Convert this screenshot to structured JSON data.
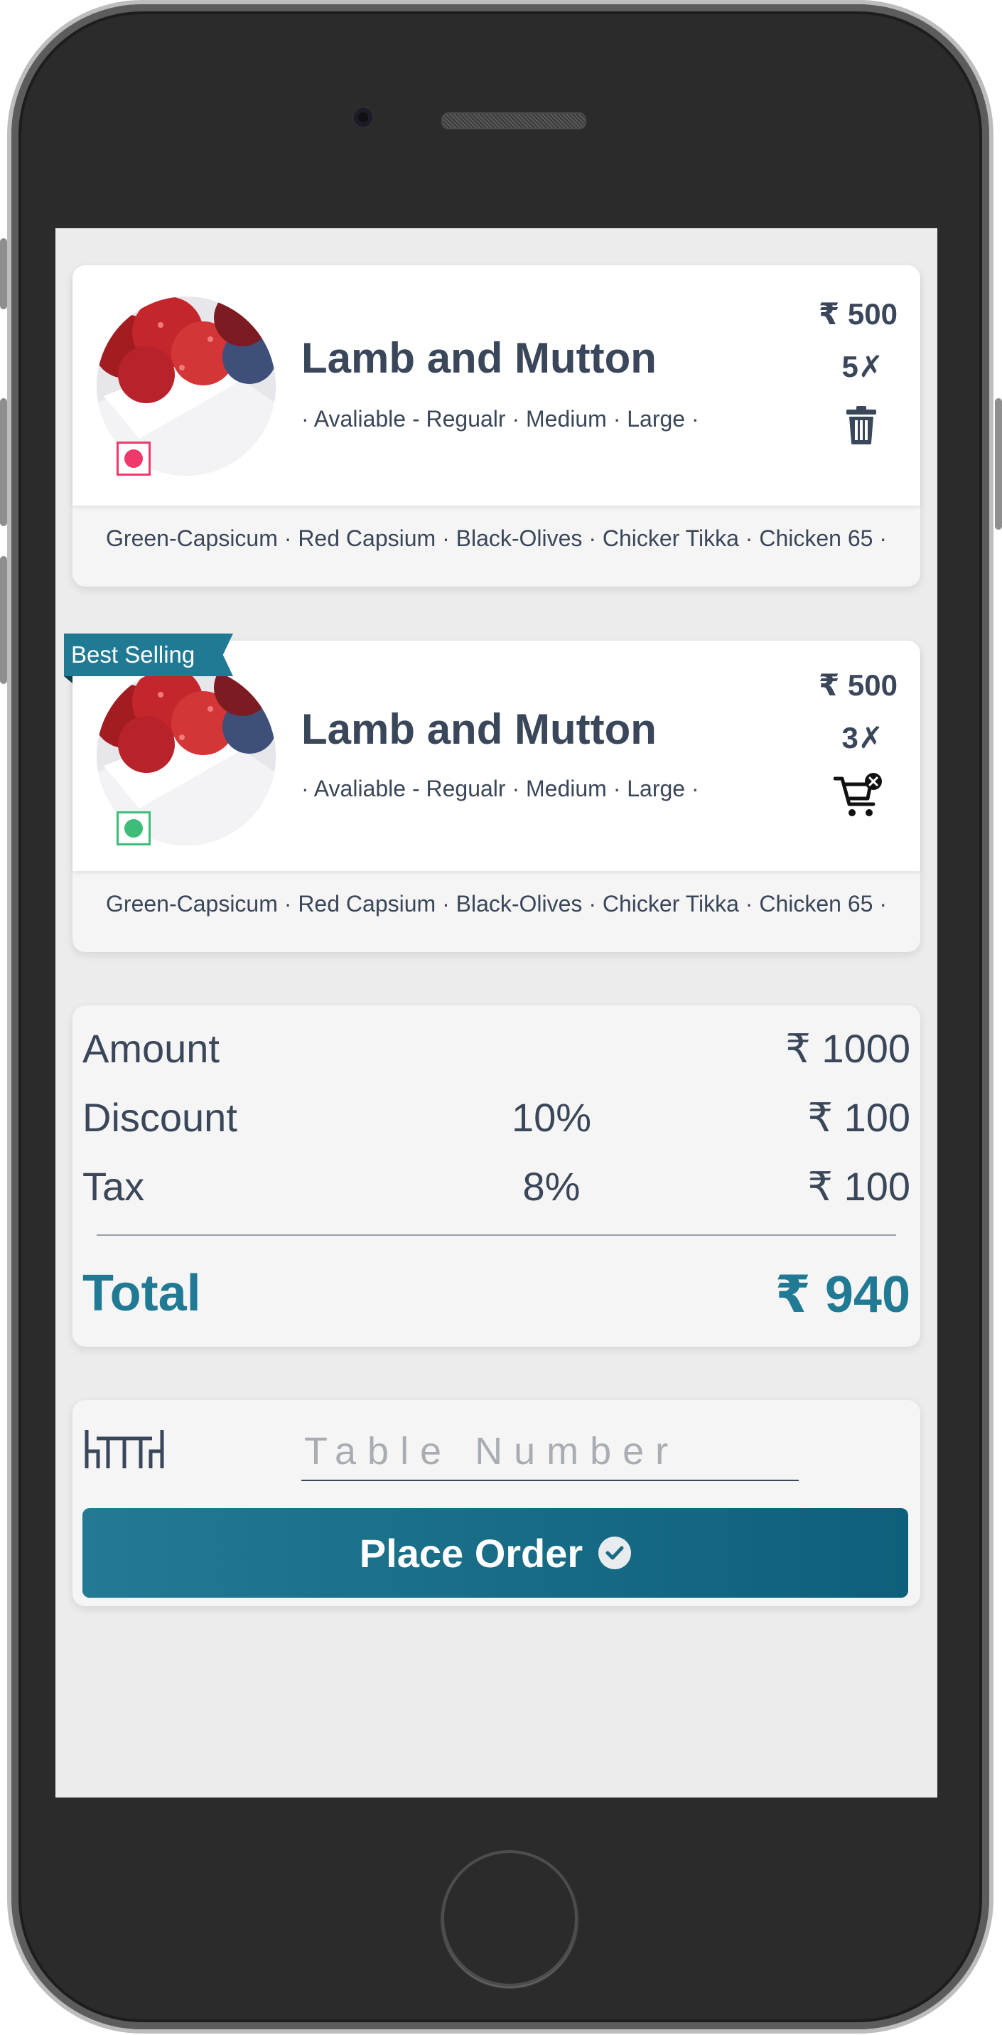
{
  "items": [
    {
      "title": "Lamb and Mutton",
      "sizes": "· Avaliable - Regualr · Medium · Large ·",
      "price": "₹ 500",
      "qty": "5✗",
      "toppings": "Green-Capsicum · Red Capsium · Black-Olives · Chicker Tikka · Chicken 65 ·",
      "diet_color": "#f0386b",
      "action_icon": "trash-icon"
    },
    {
      "badge": "Best Selling",
      "title": "Lamb and Mutton",
      "sizes": "· Avaliable - Regualr · Medium · Large ·",
      "price": "₹ 500",
      "qty": "3✗",
      "toppings": "Green-Capsicum · Red Capsium · Black-Olives · Chicker Tikka · Chicken 65 ·",
      "diet_color": "#3dbd78",
      "action_icon": "remove-from-cart-icon"
    }
  ],
  "summary": {
    "amount_label": "Amount",
    "amount_value": "₹ 1000",
    "discount_label": "Discount",
    "discount_pct": "10%",
    "discount_value": "₹ 100",
    "tax_label": "Tax",
    "tax_pct": "8%",
    "tax_value": "₹ 100",
    "total_label": "Total",
    "total_value": "₹ 940"
  },
  "order": {
    "table_placeholder": "Table Number",
    "table_value": "",
    "place_order_label": "Place Order"
  },
  "colors": {
    "accent": "#217a94",
    "text": "#3a4659",
    "nonveg": "#f0386b",
    "veg": "#3dbd78"
  }
}
